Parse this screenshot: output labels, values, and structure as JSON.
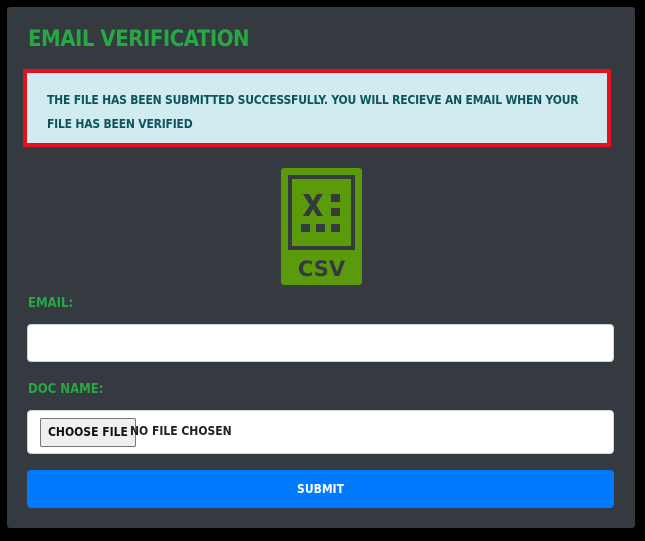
{
  "form": {
    "title": "EMAIL VERIFICATION",
    "alert_message": "THE FILE HAS BEEN SUBMITTED SUCCESSFULLY. YOU WILL RECIEVE AN EMAIL WHEN YOUR FILE HAS BEEN VERIFIED",
    "file_icon": "csv-file-icon",
    "file_icon_text": "CSV",
    "email_label": "EMAIL:",
    "email_value": "",
    "doc_name_label": "DOC NAME:",
    "choose_file_label": "CHOOSE FILE",
    "no_file_text": "NO FILE CHOSEN",
    "submit_label": "SUBMIT"
  },
  "colors": {
    "panel_background": "#343a40",
    "accent_green": "#28a745",
    "icon_green": "#5a9a0b",
    "alert_background": "#d1ecf1",
    "alert_text": "#0c5460",
    "alert_highlight_border": "#e3111e",
    "submit_blue": "#007bff"
  }
}
